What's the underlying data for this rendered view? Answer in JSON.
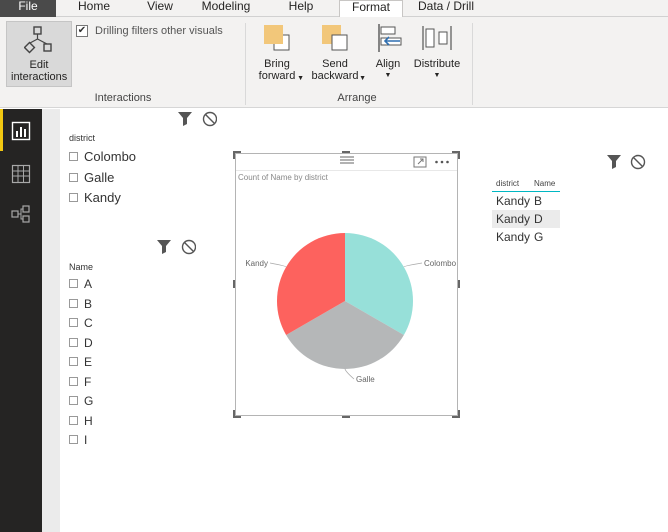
{
  "tabs": [
    {
      "label": "File"
    },
    {
      "label": "Home"
    },
    {
      "label": "View"
    },
    {
      "label": "Modeling"
    },
    {
      "label": "Help"
    },
    {
      "label": "Format",
      "active": true
    },
    {
      "label": "Data / Drill"
    }
  ],
  "ribbon": {
    "edit_interactions": "Edit interactions",
    "drilling_filters": {
      "label": "Drilling filters other visuals",
      "checked": true
    },
    "interactions_group": "Interactions",
    "bring_forward": "Bring forward",
    "send_backward": "Send backward",
    "align": "Align",
    "distribute": "Distribute",
    "arrange_group": "Arrange"
  },
  "district_slicer": {
    "title": "district",
    "items": [
      "Colombo",
      "Galle",
      "Kandy"
    ]
  },
  "name_slicer": {
    "title": "Name",
    "items": [
      "A",
      "B",
      "C",
      "D",
      "E",
      "F",
      "G",
      "H",
      "I"
    ]
  },
  "pie": {
    "title": "Count of Name by district"
  },
  "chart_data": {
    "type": "pie",
    "title": "Count of Name by district",
    "categories": [
      "Colombo",
      "Galle",
      "Kandy"
    ],
    "values": [
      3,
      3,
      3
    ],
    "colors": [
      "#97e0d9",
      "#b5b7b8",
      "#fd625e"
    ]
  },
  "table": {
    "headers": [
      "district",
      "Name"
    ],
    "rows": [
      [
        "Kandy",
        "B"
      ],
      [
        "Kandy",
        "D"
      ],
      [
        "Kandy",
        "G"
      ]
    ],
    "highlighted_row": 1
  }
}
